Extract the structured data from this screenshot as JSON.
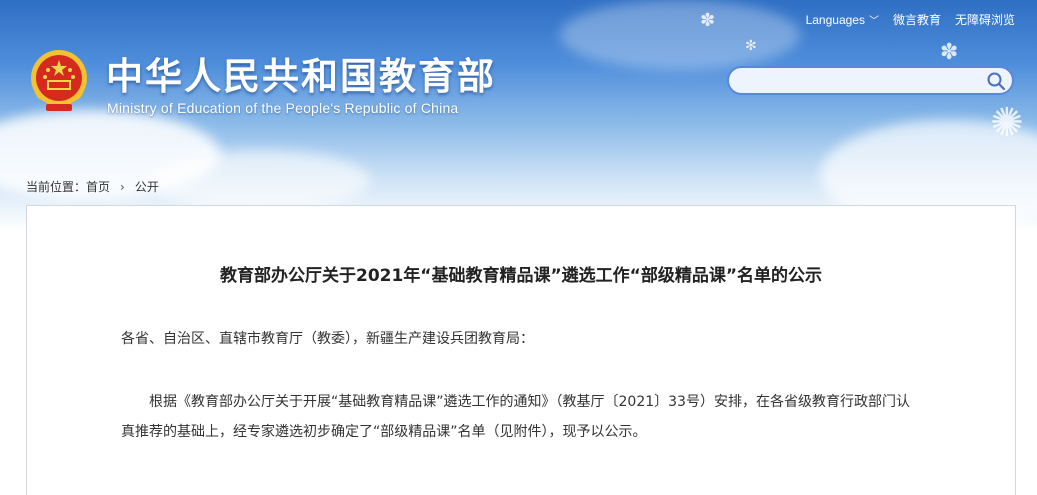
{
  "header": {
    "title_zh": "中华人民共和国教育部",
    "title_en": "Ministry of Education of the People's Republic of China",
    "links": {
      "languages": "Languages",
      "weiyan": "微言教育",
      "accessibility": "无障碍浏览"
    },
    "search": {
      "value": "",
      "placeholder": ""
    }
  },
  "breadcrumb": {
    "prefix": "当前位置：",
    "home": "首页",
    "separator": "›",
    "current": "公开"
  },
  "article": {
    "title": "教育部办公厅关于2021年“基础教育精品课”遴选工作“部级精品课”名单的公示",
    "salutation": "各省、自治区、直辖市教育厅（教委），新疆生产建设兵团教育局：",
    "body": "根据《教育部办公厅关于开展“基础教育精品课”遴选工作的通知》（教基厅〔2021〕33号）安排，在各省级教育行政部门认真推荐的基础上，经专家遴选初步确定了“部级精品课”名单（见附件），现予以公示。"
  },
  "colors": {
    "sky_top": "#2f6fc4",
    "search_border": "#5a88d8",
    "text": "#333333"
  },
  "icons": [
    "national-emblem-icon",
    "chevron-down-icon",
    "search-icon"
  ]
}
